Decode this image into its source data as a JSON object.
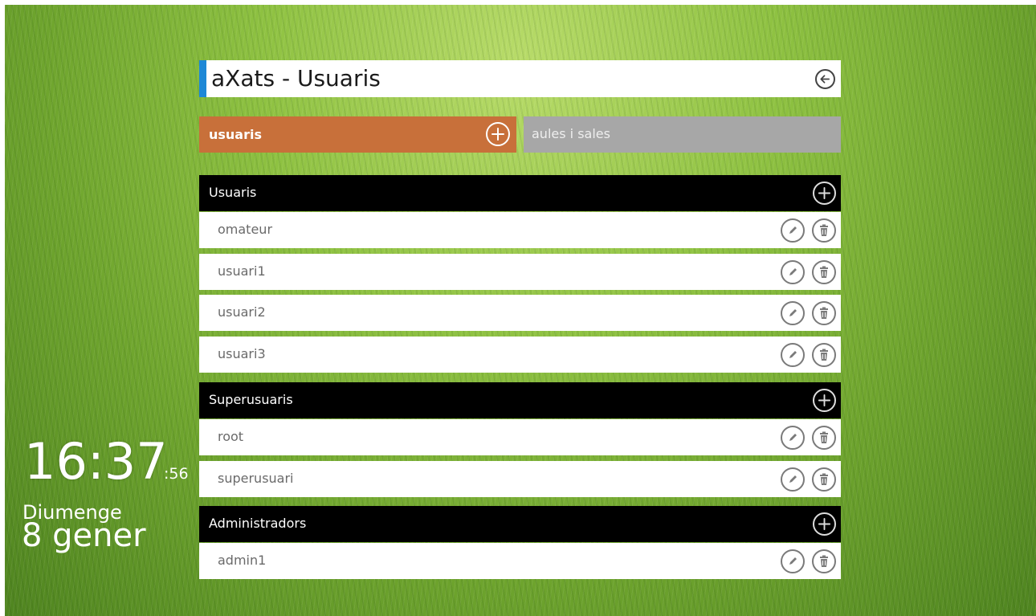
{
  "app": {
    "title": "aXats - Usuaris"
  },
  "tabs": [
    {
      "label": "usuaris",
      "active": true,
      "color": "#c8703a"
    },
    {
      "label": "aules i sales",
      "active": false,
      "color": "#a7a7a7"
    }
  ],
  "groups": [
    {
      "title": "Usuaris",
      "users": [
        "omateur",
        "usuari1",
        "usuari2",
        "usuari3"
      ]
    },
    {
      "title": "Superusuaris",
      "users": [
        "root",
        "superusuari"
      ]
    },
    {
      "title": "Administradors",
      "users": [
        "admin1"
      ]
    }
  ],
  "clock": {
    "time": "16:37",
    "seconds": ":56",
    "weekday": "Diumenge",
    "date": "8 gener"
  },
  "icons": {
    "back": "back-arrow-icon",
    "add": "plus-icon",
    "edit": "pencil-icon",
    "delete": "trash-icon"
  },
  "colors": {
    "accent": "#1e88d6",
    "header": "#000000"
  }
}
